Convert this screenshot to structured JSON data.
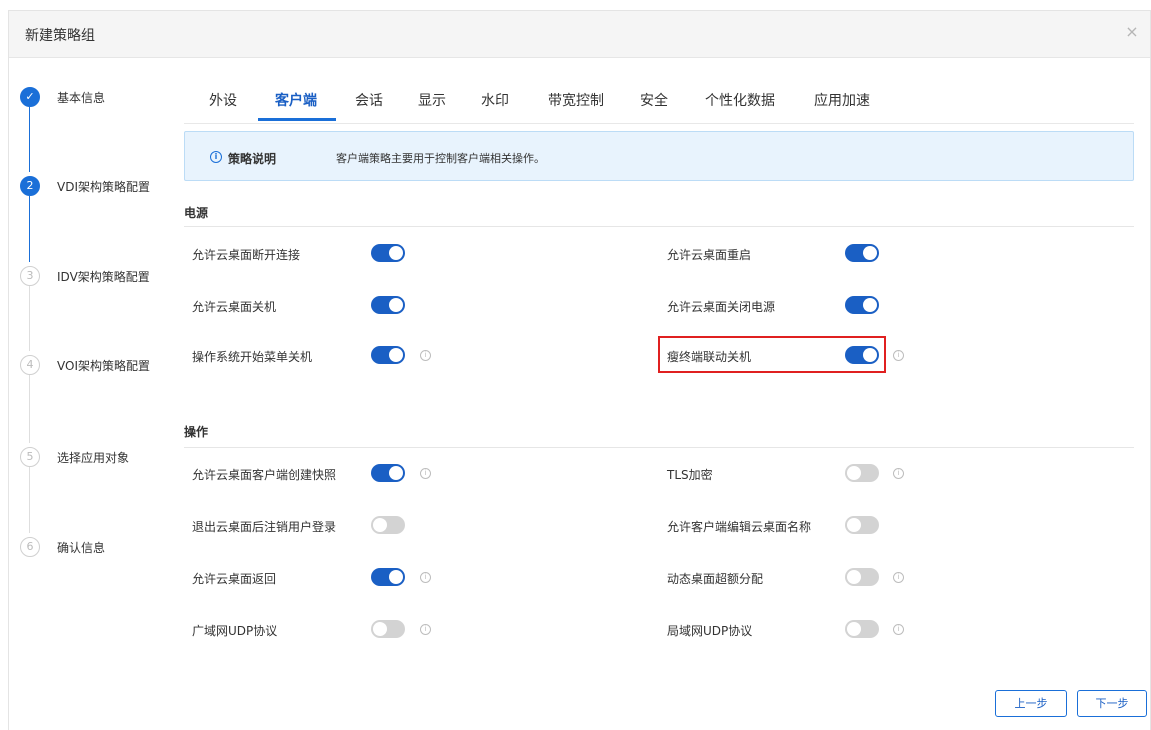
{
  "dialog": {
    "title": "新建策略组",
    "close_symbol": "×"
  },
  "steps": [
    {
      "number": "✓",
      "label": "基本信息",
      "state": "done"
    },
    {
      "number": "2",
      "label": "VDI架构策略配置",
      "state": "active"
    },
    {
      "number": "3",
      "label": "IDV架构策略配置",
      "state": "todo"
    },
    {
      "number": "4",
      "label": "VOI架构策略配置",
      "state": "todo"
    },
    {
      "number": "5",
      "label": "选择应用对象",
      "state": "todo"
    },
    {
      "number": "6",
      "label": "确认信息",
      "state": "todo"
    }
  ],
  "tabs": [
    "外设",
    "客户端",
    "会话",
    "显示",
    "水印",
    "带宽控制",
    "安全",
    "个性化数据",
    "应用加速"
  ],
  "active_tab": "客户端",
  "info": {
    "title": "策略说明",
    "text": "客户端策略主要用于控制客户端相关操作。",
    "icon": "info-icon"
  },
  "sections": {
    "power": {
      "title": "电源",
      "left": [
        {
          "label": "允许云桌面断开连接",
          "on": true,
          "hint": false
        },
        {
          "label": "允许云桌面关机",
          "on": true,
          "hint": false
        },
        {
          "label": "操作系统开始菜单关机",
          "on": true,
          "hint": true
        }
      ],
      "right": [
        {
          "label": "允许云桌面重启",
          "on": true,
          "hint": false
        },
        {
          "label": "允许云桌面关闭电源",
          "on": true,
          "hint": false
        },
        {
          "label": "瘦终端联动关机",
          "on": true,
          "hint": true
        }
      ]
    },
    "ops": {
      "title": "操作",
      "left": [
        {
          "label": "允许云桌面客户端创建快照",
          "on": true,
          "hint": true
        },
        {
          "label": "退出云桌面后注销用户登录",
          "on": false,
          "hint": false
        },
        {
          "label": "允许云桌面返回",
          "on": true,
          "hint": true
        },
        {
          "label": "广域网UDP协议",
          "on": false,
          "hint": true
        }
      ],
      "right": [
        {
          "label": "TLS加密",
          "on": false,
          "hint": true
        },
        {
          "label": "允许客户端编辑云桌面名称",
          "on": false,
          "hint": false
        },
        {
          "label": "动态桌面超额分配",
          "on": false,
          "hint": true
        },
        {
          "label": "局域网UDP协议",
          "on": false,
          "hint": true
        }
      ]
    }
  },
  "buttons": {
    "prev": "上一步",
    "next": "下一步"
  },
  "colors": {
    "accent": "#1a6fd8",
    "toggle_on": "#1a5fc4",
    "toggle_off": "#d3d3d3",
    "highlight": "#e02020"
  }
}
